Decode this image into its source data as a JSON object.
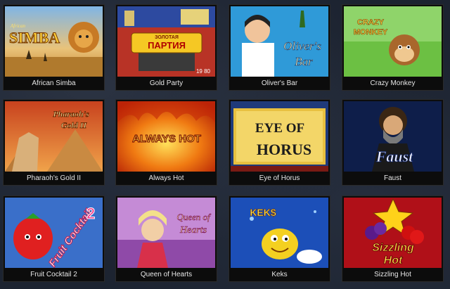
{
  "games": [
    {
      "title": "African Simba",
      "logo": "SIMBA",
      "logo_prefix": "African"
    },
    {
      "title": "Gold Party",
      "logo": "ПАРТИЯ",
      "logo_top": "ЗОЛОТАЯ",
      "numbers": "19 80"
    },
    {
      "title": "Oliver's Bar",
      "logo": "Oliver's",
      "logo2": "Bar"
    },
    {
      "title": "Crazy Monkey",
      "logo": "CRAZY",
      "logo2": "MONKEY"
    },
    {
      "title": "Pharaoh's Gold II",
      "logo": "Pharaoh's",
      "logo2": "Gold II"
    },
    {
      "title": "Always Hot",
      "logo": "ALWAYS HOT"
    },
    {
      "title": "Eye of Horus",
      "logo": "EYE OF",
      "logo2": "HORUS"
    },
    {
      "title": "Faust",
      "logo": "Faust"
    },
    {
      "title": "Fruit Cocktail 2",
      "logo": "Fruit Cocktail",
      "logo2": "2"
    },
    {
      "title": "Queen of Hearts",
      "logo": "Queen of",
      "logo2": "Hearts"
    },
    {
      "title": "Keks",
      "logo": "KEK$"
    },
    {
      "title": "Sizzling Hot",
      "logo": "Sizzling",
      "logo2": "Hot"
    }
  ]
}
